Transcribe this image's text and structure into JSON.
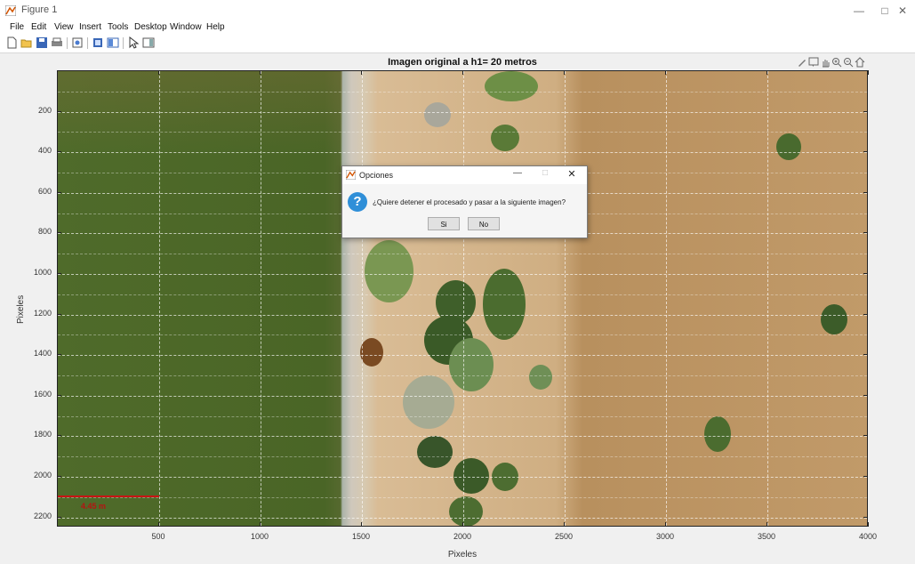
{
  "window": {
    "title": "Figure 1",
    "minimize": "—",
    "maximize": "□",
    "close": "✕"
  },
  "menu": [
    "File",
    "Edit",
    "View",
    "Insert",
    "Tools",
    "Desktop",
    "Window",
    "Help"
  ],
  "toolbar_icons": [
    "new-figure-icon",
    "open-file-icon",
    "save-icon",
    "print-icon",
    "print-preview-icon",
    "link-plot-icon",
    "insert-colorbar-icon",
    "edit-plot-icon",
    "plot-tools-icon"
  ],
  "axes_toolbar_icons": [
    "brush-icon",
    "datatip-icon",
    "pan-icon",
    "zoom-in-icon",
    "zoom-out-icon",
    "home-icon"
  ],
  "plot": {
    "title": "Imagen original a h1= 20 metros",
    "xlabel": "Pixeles",
    "ylabel": "Pixeles",
    "xticks": [
      "500",
      "1000",
      "1500",
      "2000",
      "2500",
      "3000",
      "3500",
      "4000"
    ],
    "yticks": [
      "200",
      "400",
      "600",
      "800",
      "1000",
      "1200",
      "1400",
      "1600",
      "1800",
      "2000",
      "2200"
    ],
    "scale_label": "4.45 m",
    "colors": {
      "scale_bar": "#c81414"
    }
  },
  "dialog": {
    "title": "Opciones",
    "message": "¿Quiere detener el procesado y pasar a la siguiente imagen?",
    "yes_label": "Si",
    "no_label": "No",
    "minimize": "—",
    "maximize": "□",
    "close": "✕",
    "icon": "question-icon"
  }
}
